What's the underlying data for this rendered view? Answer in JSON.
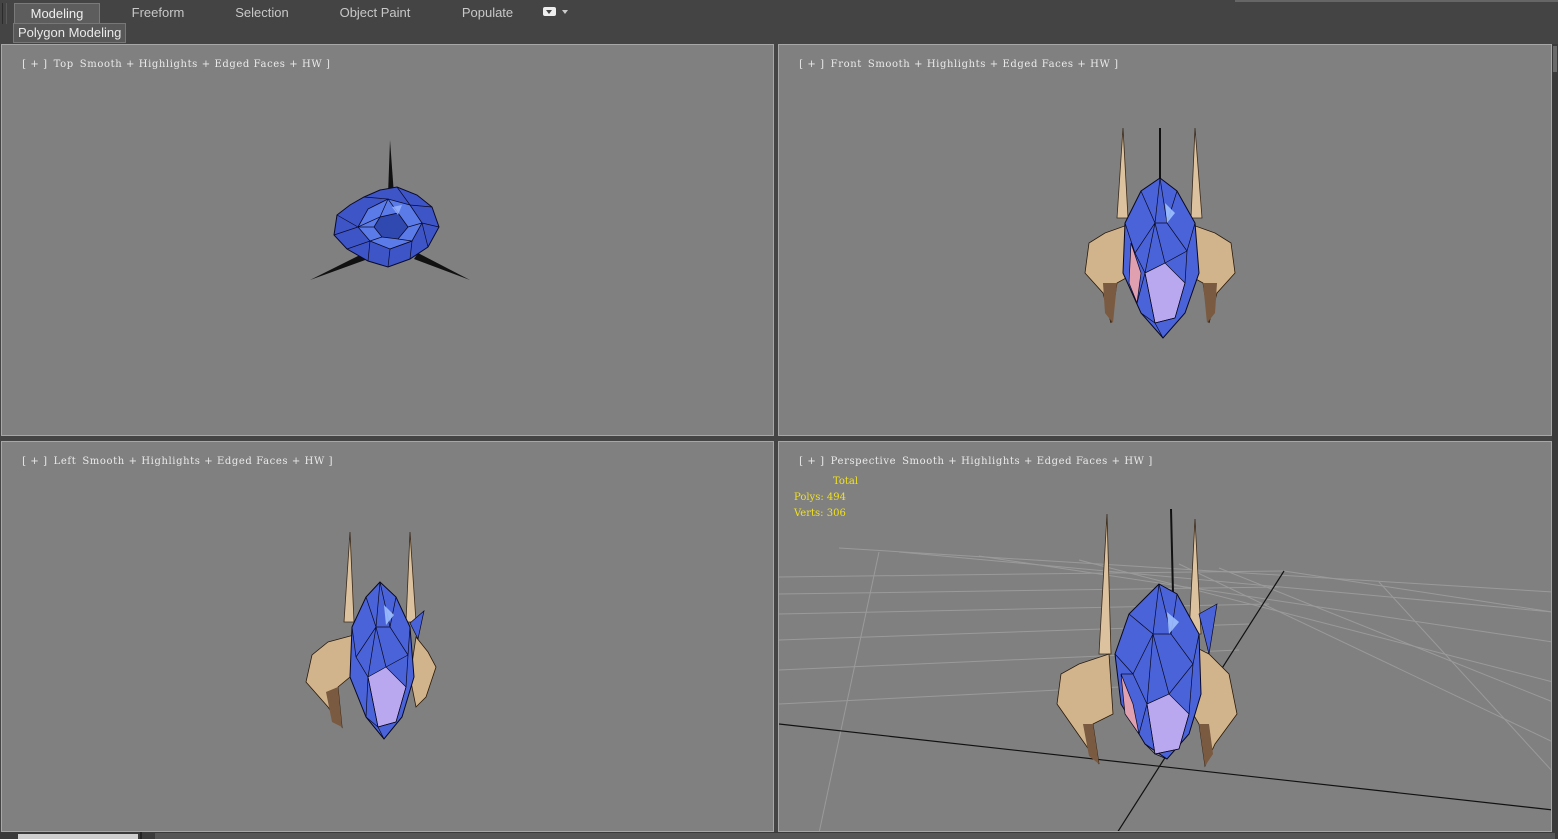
{
  "ribbon": {
    "tabs": [
      {
        "label": "Modeling",
        "active": true
      },
      {
        "label": "Freeform",
        "active": false
      },
      {
        "label": "Selection",
        "active": false
      },
      {
        "label": "Object Paint",
        "active": false
      },
      {
        "label": "Populate",
        "active": false
      }
    ],
    "options_icon": "dropdown-options-icon",
    "subtab": "Polygon Modeling"
  },
  "viewports": {
    "top": {
      "plus": "[ + ]",
      "view": "Top",
      "shading": "Smooth + Highlights + Edged Faces + HW ]"
    },
    "front": {
      "plus": "[ + ]",
      "view": "Front",
      "shading": "Smooth + Highlights + Edged Faces + HW ]"
    },
    "left": {
      "plus": "[ + ]",
      "view": "Left",
      "shading": "Smooth + Highlights + Edged Faces + HW ]"
    },
    "perspective": {
      "plus": "[ + ]",
      "view": "Perspective",
      "shading": "Smooth + Highlights + Edged Faces + HW ]",
      "stats": {
        "total_label": "Total",
        "polys_label": "Polys:",
        "polys": "494",
        "verts_label": "Verts:",
        "verts": "306"
      }
    }
  },
  "colors": {
    "viewport_bg": "#808080",
    "ui_bg": "#444444",
    "stats_text": "#f0e020",
    "crystal": "#4a5fd0",
    "horn": "#d8bc98"
  }
}
